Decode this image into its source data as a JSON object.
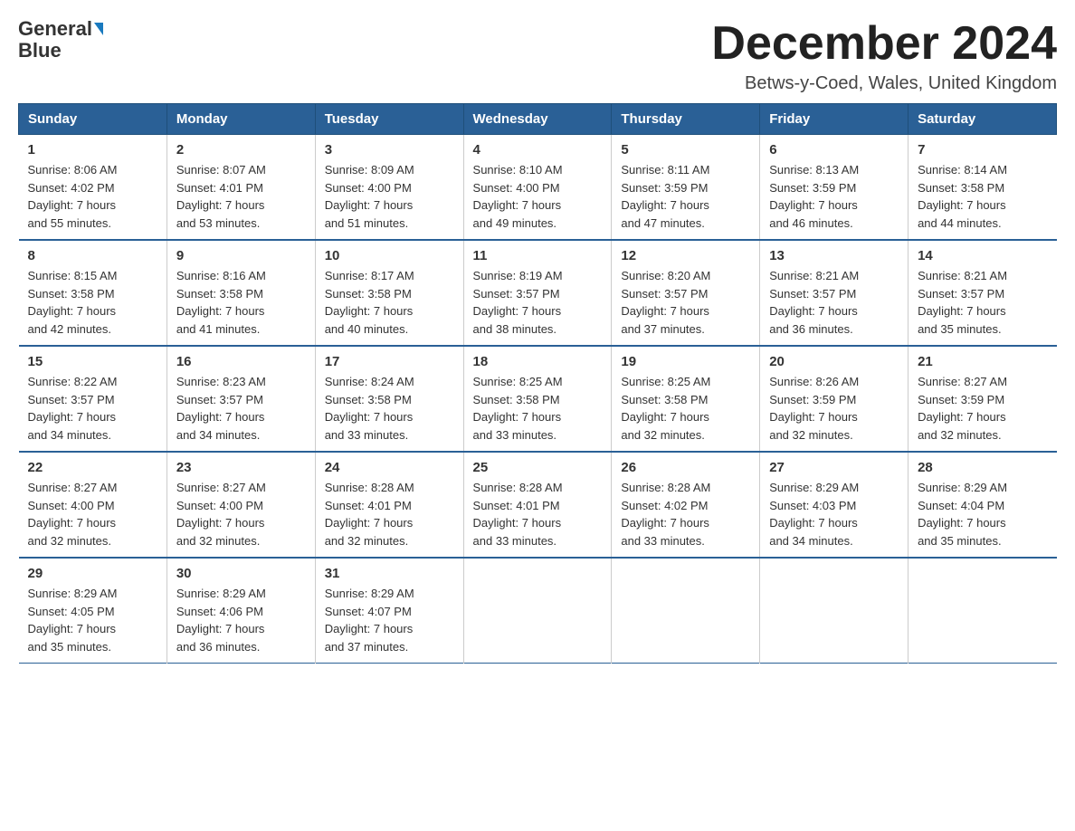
{
  "header": {
    "logo_line1": "General",
    "logo_arrow": true,
    "logo_line2": "Blue",
    "month_title": "December 2024",
    "location": "Betws-y-Coed, Wales, United Kingdom"
  },
  "weekdays": [
    "Sunday",
    "Monday",
    "Tuesday",
    "Wednesday",
    "Thursday",
    "Friday",
    "Saturday"
  ],
  "weeks": [
    [
      {
        "day": "1",
        "sunrise": "8:06 AM",
        "sunset": "4:02 PM",
        "daylight": "7 hours and 55 minutes."
      },
      {
        "day": "2",
        "sunrise": "8:07 AM",
        "sunset": "4:01 PM",
        "daylight": "7 hours and 53 minutes."
      },
      {
        "day": "3",
        "sunrise": "8:09 AM",
        "sunset": "4:00 PM",
        "daylight": "7 hours and 51 minutes."
      },
      {
        "day": "4",
        "sunrise": "8:10 AM",
        "sunset": "4:00 PM",
        "daylight": "7 hours and 49 minutes."
      },
      {
        "day": "5",
        "sunrise": "8:11 AM",
        "sunset": "3:59 PM",
        "daylight": "7 hours and 47 minutes."
      },
      {
        "day": "6",
        "sunrise": "8:13 AM",
        "sunset": "3:59 PM",
        "daylight": "7 hours and 46 minutes."
      },
      {
        "day": "7",
        "sunrise": "8:14 AM",
        "sunset": "3:58 PM",
        "daylight": "7 hours and 44 minutes."
      }
    ],
    [
      {
        "day": "8",
        "sunrise": "8:15 AM",
        "sunset": "3:58 PM",
        "daylight": "7 hours and 42 minutes."
      },
      {
        "day": "9",
        "sunrise": "8:16 AM",
        "sunset": "3:58 PM",
        "daylight": "7 hours and 41 minutes."
      },
      {
        "day": "10",
        "sunrise": "8:17 AM",
        "sunset": "3:58 PM",
        "daylight": "7 hours and 40 minutes."
      },
      {
        "day": "11",
        "sunrise": "8:19 AM",
        "sunset": "3:57 PM",
        "daylight": "7 hours and 38 minutes."
      },
      {
        "day": "12",
        "sunrise": "8:20 AM",
        "sunset": "3:57 PM",
        "daylight": "7 hours and 37 minutes."
      },
      {
        "day": "13",
        "sunrise": "8:21 AM",
        "sunset": "3:57 PM",
        "daylight": "7 hours and 36 minutes."
      },
      {
        "day": "14",
        "sunrise": "8:21 AM",
        "sunset": "3:57 PM",
        "daylight": "7 hours and 35 minutes."
      }
    ],
    [
      {
        "day": "15",
        "sunrise": "8:22 AM",
        "sunset": "3:57 PM",
        "daylight": "7 hours and 34 minutes."
      },
      {
        "day": "16",
        "sunrise": "8:23 AM",
        "sunset": "3:57 PM",
        "daylight": "7 hours and 34 minutes."
      },
      {
        "day": "17",
        "sunrise": "8:24 AM",
        "sunset": "3:58 PM",
        "daylight": "7 hours and 33 minutes."
      },
      {
        "day": "18",
        "sunrise": "8:25 AM",
        "sunset": "3:58 PM",
        "daylight": "7 hours and 33 minutes."
      },
      {
        "day": "19",
        "sunrise": "8:25 AM",
        "sunset": "3:58 PM",
        "daylight": "7 hours and 32 minutes."
      },
      {
        "day": "20",
        "sunrise": "8:26 AM",
        "sunset": "3:59 PM",
        "daylight": "7 hours and 32 minutes."
      },
      {
        "day": "21",
        "sunrise": "8:27 AM",
        "sunset": "3:59 PM",
        "daylight": "7 hours and 32 minutes."
      }
    ],
    [
      {
        "day": "22",
        "sunrise": "8:27 AM",
        "sunset": "4:00 PM",
        "daylight": "7 hours and 32 minutes."
      },
      {
        "day": "23",
        "sunrise": "8:27 AM",
        "sunset": "4:00 PM",
        "daylight": "7 hours and 32 minutes."
      },
      {
        "day": "24",
        "sunrise": "8:28 AM",
        "sunset": "4:01 PM",
        "daylight": "7 hours and 32 minutes."
      },
      {
        "day": "25",
        "sunrise": "8:28 AM",
        "sunset": "4:01 PM",
        "daylight": "7 hours and 33 minutes."
      },
      {
        "day": "26",
        "sunrise": "8:28 AM",
        "sunset": "4:02 PM",
        "daylight": "7 hours and 33 minutes."
      },
      {
        "day": "27",
        "sunrise": "8:29 AM",
        "sunset": "4:03 PM",
        "daylight": "7 hours and 34 minutes."
      },
      {
        "day": "28",
        "sunrise": "8:29 AM",
        "sunset": "4:04 PM",
        "daylight": "7 hours and 35 minutes."
      }
    ],
    [
      {
        "day": "29",
        "sunrise": "8:29 AM",
        "sunset": "4:05 PM",
        "daylight": "7 hours and 35 minutes."
      },
      {
        "day": "30",
        "sunrise": "8:29 AM",
        "sunset": "4:06 PM",
        "daylight": "7 hours and 36 minutes."
      },
      {
        "day": "31",
        "sunrise": "8:29 AM",
        "sunset": "4:07 PM",
        "daylight": "7 hours and 37 minutes."
      },
      null,
      null,
      null,
      null
    ]
  ]
}
